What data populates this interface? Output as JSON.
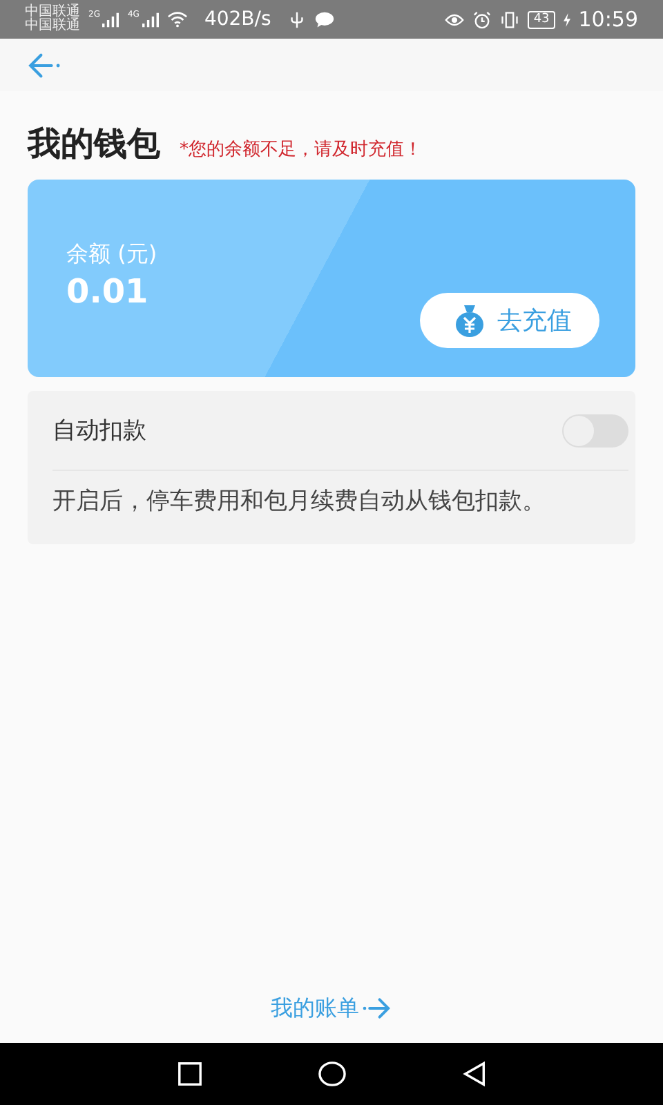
{
  "status_bar": {
    "carriers": [
      "中国联通",
      "中国联通"
    ],
    "net_types": [
      "2G",
      "4G"
    ],
    "speed": "402B/s",
    "battery": "43",
    "time": "10:59"
  },
  "title": "我的钱包",
  "warning": "*您的余额不足，请及时充值！",
  "balance": {
    "label": "余额 (元)",
    "amount": "0.01",
    "button": "去充值"
  },
  "auto_deduct": {
    "label": "自动扣款",
    "on": false,
    "description": "开启后，停车费用和包月续费自动从钱包扣款。"
  },
  "bill_link": "我的账单"
}
